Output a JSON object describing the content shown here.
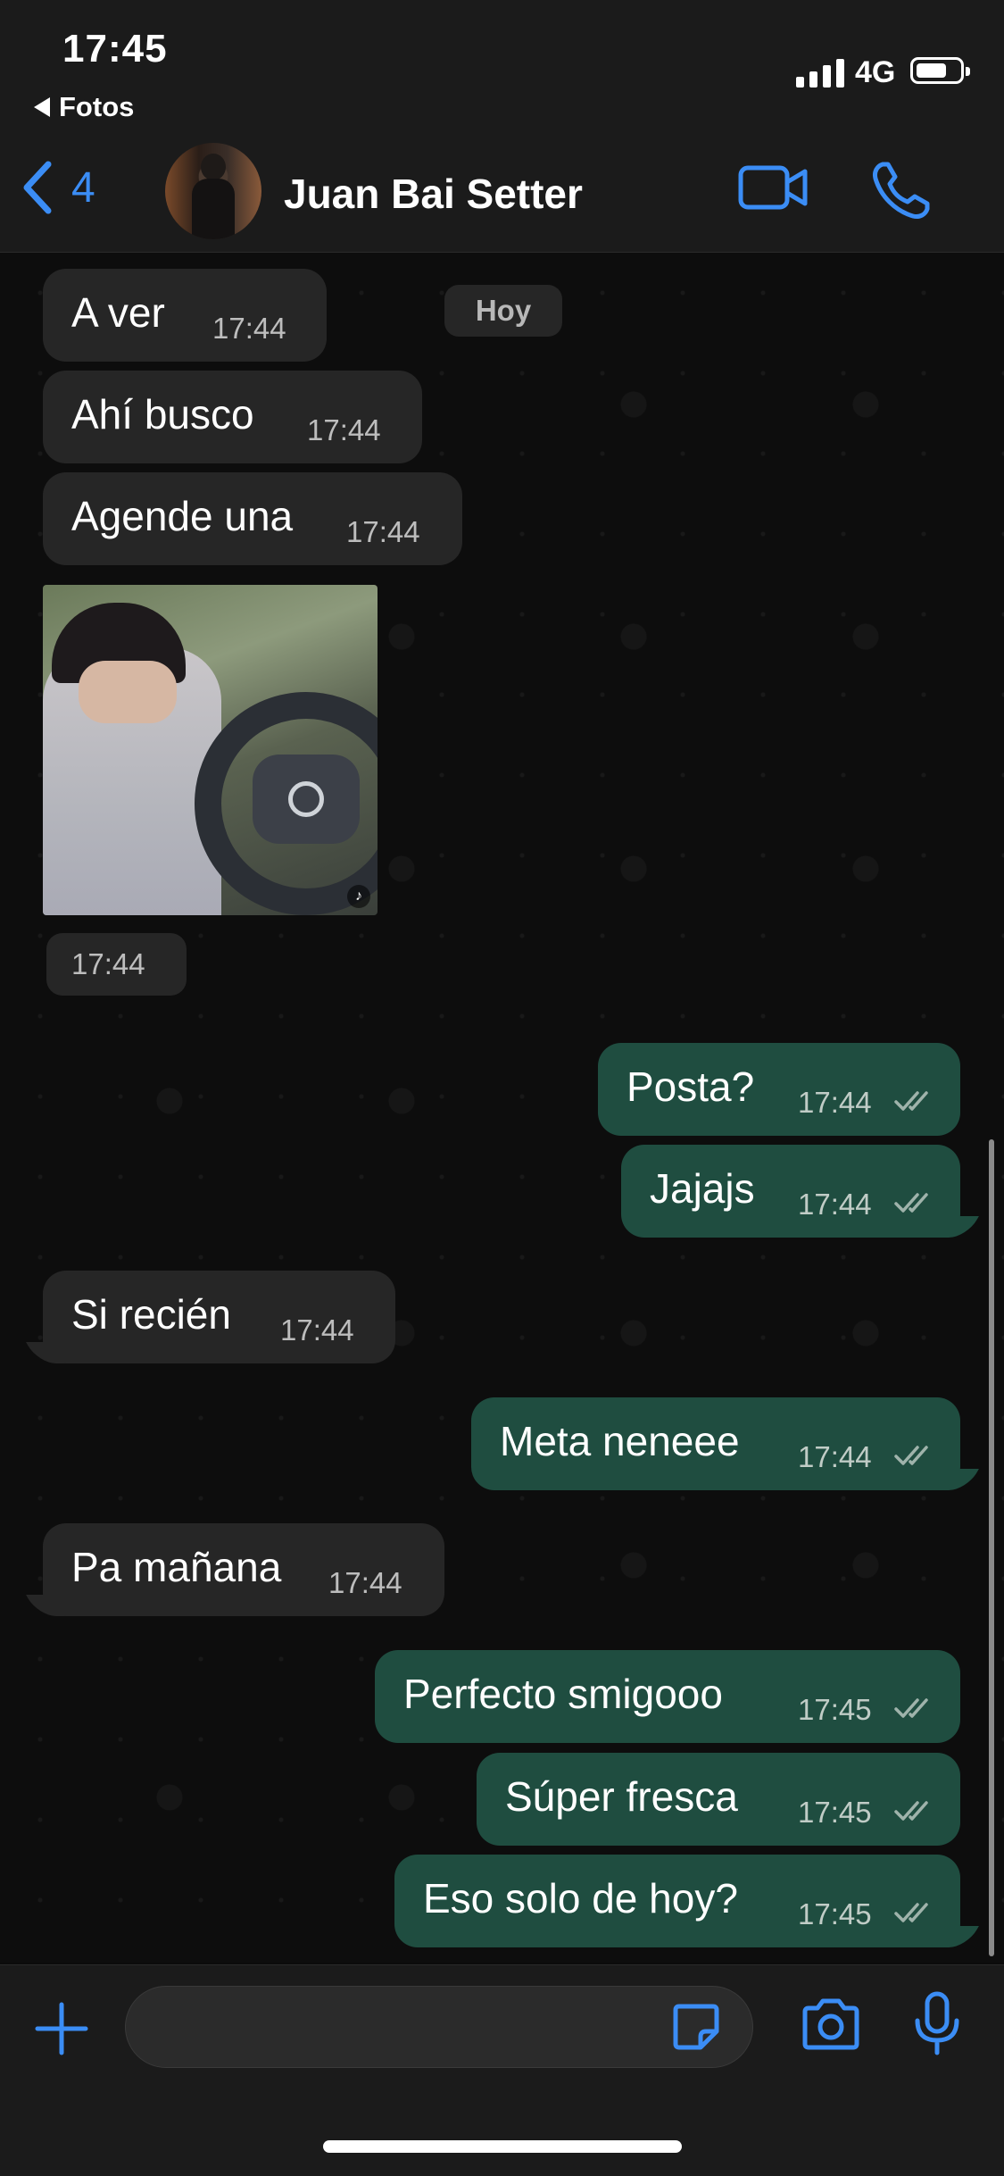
{
  "status_bar": {
    "time": "17:45",
    "back_app": "Fotos",
    "network": "4G",
    "battery_percent": 55
  },
  "header": {
    "back_count": "4",
    "contact_name": "Juan Bai Setter",
    "icons": [
      "chevron-left-icon",
      "video-call-icon",
      "phone-icon"
    ]
  },
  "chat": {
    "date_label": "Hoy",
    "messages": [
      {
        "dir": "in",
        "text": "A ver",
        "time": "17:44"
      },
      {
        "dir": "in",
        "text": "Ahí busco",
        "time": "17:44"
      },
      {
        "dir": "in",
        "text": "Agende una",
        "time": "17:44"
      },
      {
        "dir": "in",
        "type": "video",
        "time": "17:44"
      },
      {
        "dir": "out",
        "text": "Posta?",
        "time": "17:44",
        "read": true
      },
      {
        "dir": "out",
        "text": "Jajajs",
        "time": "17:44",
        "read": true
      },
      {
        "dir": "in",
        "text": "Si recién",
        "time": "17:44"
      },
      {
        "dir": "out",
        "text": "Meta neneee",
        "time": "17:44",
        "read": true
      },
      {
        "dir": "in",
        "text": "Pa mañana",
        "time": "17:44"
      },
      {
        "dir": "out",
        "text": "Perfecto smigooo",
        "time": "17:45",
        "read": true
      },
      {
        "dir": "out",
        "text": "Súper fresca",
        "time": "17:45",
        "read": true
      },
      {
        "dir": "out",
        "text": "Eso solo de hoy?",
        "time": "17:45",
        "read": true
      }
    ]
  },
  "input_bar": {
    "icons": [
      "plus-icon",
      "sticker-icon",
      "camera-icon",
      "microphone-icon"
    ]
  },
  "colors": {
    "accent": "#3b8df5",
    "incoming_bubble": "#262626",
    "outgoing_bubble": "#1f4d40",
    "background": "#0b0b0b"
  }
}
